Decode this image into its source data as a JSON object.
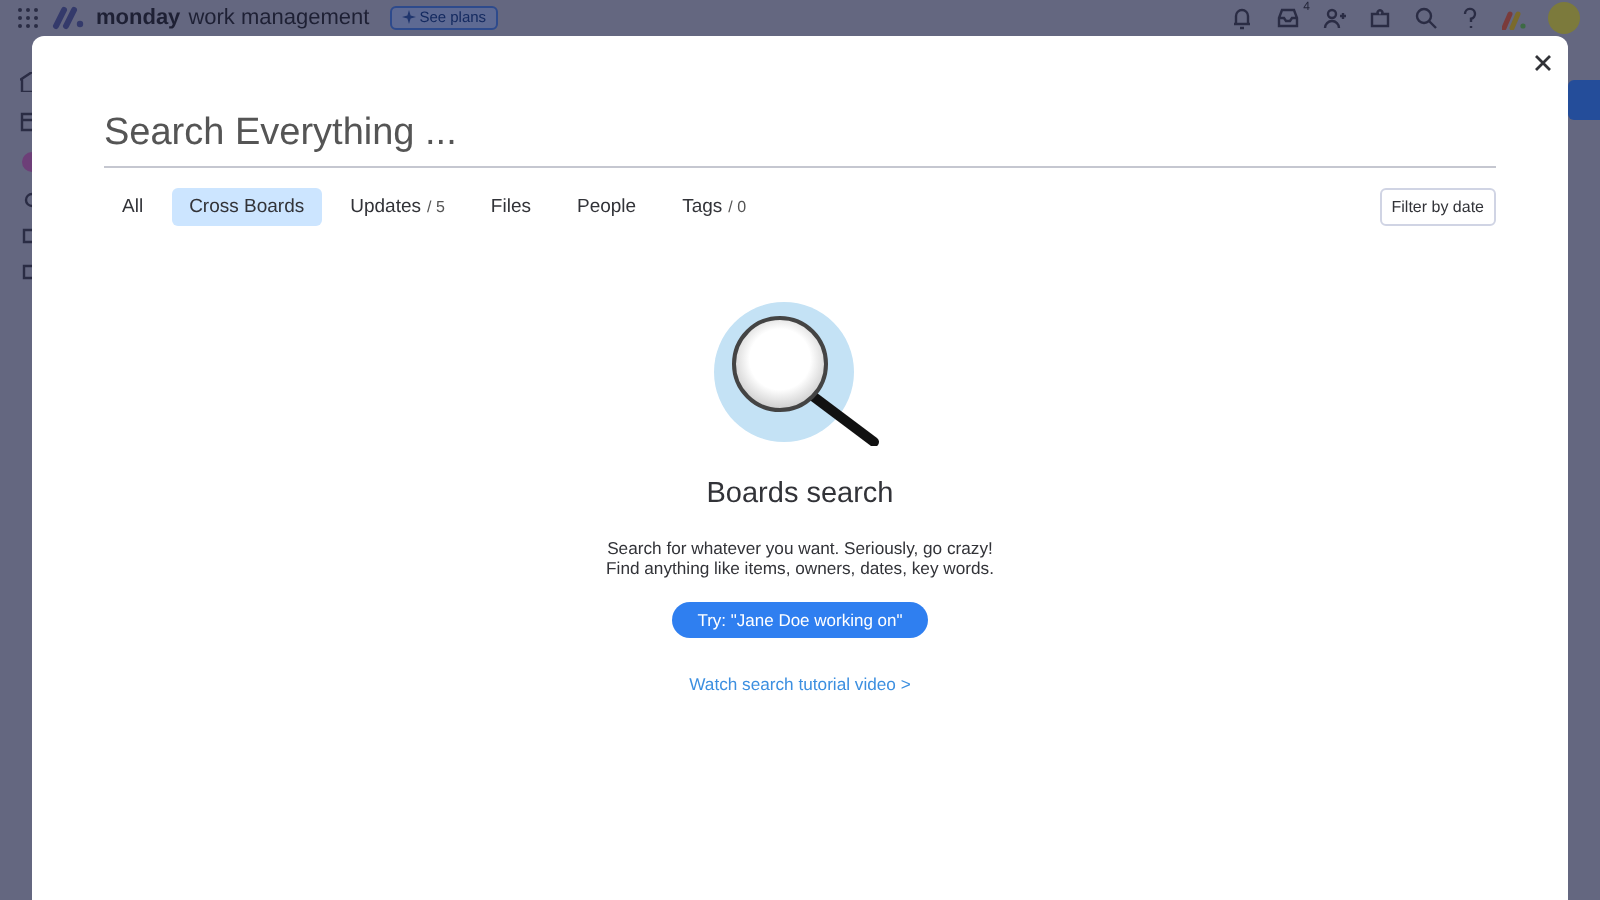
{
  "app_header": {
    "brand": "monday",
    "product": "work management",
    "plans_button": "See plans",
    "inbox_badge": "4"
  },
  "search": {
    "placeholder": "Search Everything ..."
  },
  "tabs": [
    {
      "label": "All",
      "selected": false
    },
    {
      "label": "Cross Boards",
      "selected": true
    },
    {
      "label": "Updates",
      "count": "/ 5",
      "selected": false
    },
    {
      "label": "Files",
      "selected": false
    },
    {
      "label": "People",
      "selected": false
    },
    {
      "label": "Tags",
      "count": "/ 0",
      "selected": false
    }
  ],
  "filter_button": "Filter by date",
  "empty_state": {
    "title": "Boards search",
    "description": [
      "Search for whatever you want. Seriously, go crazy!",
      "Find anything like items, owners, dates, key words."
    ],
    "try_button": "Try: \"Jane Doe working on\"",
    "tutorial_link": "Watch search tutorial video >"
  }
}
